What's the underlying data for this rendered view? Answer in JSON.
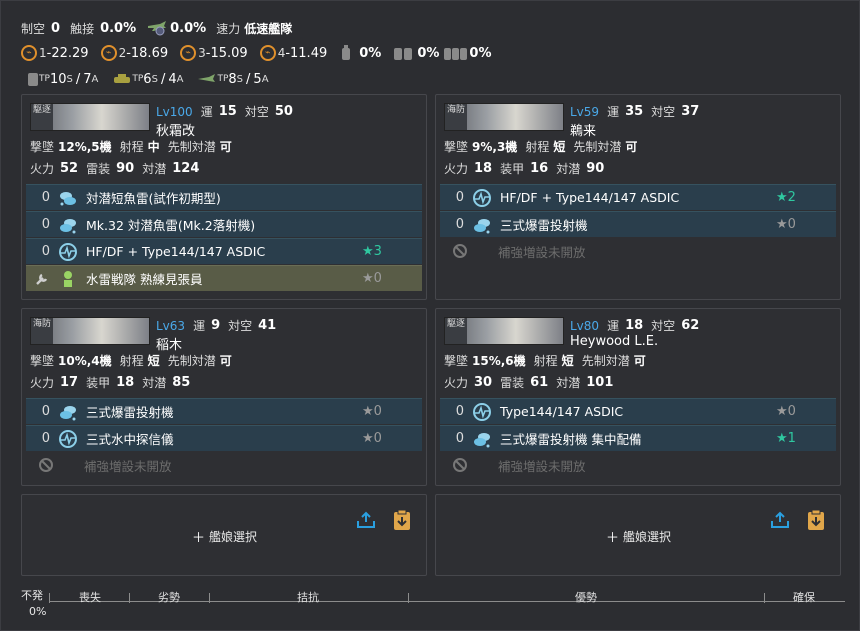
{
  "summary": {
    "air_label": "制空",
    "air_value": "0",
    "contact_label": "触接",
    "contact_value": "0.0%",
    "other_value": "0.0%",
    "speed_label": "速力",
    "speed_value": "低速艦隊",
    "los": [
      {
        "icon": "los-icon",
        "sub": "1",
        "value": "-22.29"
      },
      {
        "icon": "los-icon",
        "sub": "2",
        "value": "-18.69"
      },
      {
        "icon": "los-icon",
        "sub": "3",
        "value": "-15.09"
      },
      {
        "icon": "los-icon",
        "sub": "4",
        "value": "-11.49"
      }
    ],
    "drums": [
      "0%",
      "0%",
      "0%"
    ],
    "tp": [
      {
        "icon": "drum-tp-icon",
        "s": "10",
        "a": "7"
      },
      {
        "icon": "tank-tp-icon",
        "s": "6",
        "a": "4"
      },
      {
        "icon": "seaplane-tp-icon",
        "s": "8",
        "a": "5"
      }
    ],
    "tp_prefix": "TP",
    "tp_s": "S",
    "tp_a": "A"
  },
  "ships": [
    {
      "type_tag": "駆逐",
      "level": "Lv100",
      "luck_label": "運",
      "luck": "15",
      "aa_label": "対空",
      "aa": "50",
      "name": "秋霜改",
      "line2": [
        {
          "label": "撃墜",
          "value": "12%,5機"
        },
        {
          "label": "射程",
          "value": "中"
        },
        {
          "label": "先制対潜",
          "value": "可"
        }
      ],
      "line3": [
        {
          "label": "火力",
          "value": "52"
        },
        {
          "label": "雷装",
          "value": "90"
        },
        {
          "label": "対潜",
          "value": "124"
        }
      ],
      "equips": [
        {
          "count": "0",
          "icon": "depth-charge-icon",
          "name": "対潜短魚雷(試作初期型)",
          "star": ""
        },
        {
          "count": "0",
          "icon": "depth-charge-icon",
          "name": "Mk.32 対潜魚雷(Mk.2落射機)",
          "star": ""
        },
        {
          "count": "0",
          "icon": "sonar-icon",
          "name": "HF/DF + Type144/147 ASDIC",
          "star": "3"
        }
      ],
      "expansion": {
        "icon": "lookout-icon",
        "name": "水雷戦隊 熟練見張員",
        "star": "0"
      }
    },
    {
      "type_tag": "海防",
      "level": "Lv59",
      "luck_label": "運",
      "luck": "35",
      "aa_label": "対空",
      "aa": "37",
      "name": "鵜来",
      "line2": [
        {
          "label": "撃墜",
          "value": "9%,3機"
        },
        {
          "label": "射程",
          "value": "短"
        },
        {
          "label": "先制対潜",
          "value": "可"
        }
      ],
      "line3": [
        {
          "label": "火力",
          "value": "18"
        },
        {
          "label": "装甲",
          "value": "16"
        },
        {
          "label": "対潜",
          "value": "90"
        }
      ],
      "equips": [
        {
          "count": "0",
          "icon": "sonar-icon",
          "name": "HF/DF + Type144/147 ASDIC",
          "star": "2"
        },
        {
          "count": "0",
          "icon": "depth-charge-icon",
          "name": "三式爆雷投射機",
          "star": "0"
        }
      ],
      "locked": "補強増設未開放"
    },
    {
      "type_tag": "海防",
      "level": "Lv63",
      "luck_label": "運",
      "luck": "9",
      "aa_label": "対空",
      "aa": "41",
      "name": "稲木",
      "line2": [
        {
          "label": "撃墜",
          "value": "10%,4機"
        },
        {
          "label": "射程",
          "value": "短"
        },
        {
          "label": "先制対潜",
          "value": "可"
        }
      ],
      "line3": [
        {
          "label": "火力",
          "value": "17"
        },
        {
          "label": "装甲",
          "value": "18"
        },
        {
          "label": "対潜",
          "value": "85"
        }
      ],
      "equips": [
        {
          "count": "0",
          "icon": "depth-charge-icon",
          "name": "三式爆雷投射機",
          "star": "0"
        },
        {
          "count": "0",
          "icon": "sonar-icon",
          "name": "三式水中探信儀",
          "star": "0"
        }
      ],
      "locked": "補強増設未開放"
    },
    {
      "type_tag": "駆逐",
      "level": "Lv80",
      "luck_label": "運",
      "luck": "18",
      "aa_label": "対空",
      "aa": "62",
      "name": "Heywood L.E.",
      "line2": [
        {
          "label": "撃墜",
          "value": "15%,6機"
        },
        {
          "label": "射程",
          "value": "短"
        },
        {
          "label": "先制対潜",
          "value": "可"
        }
      ],
      "line3": [
        {
          "label": "火力",
          "value": "30"
        },
        {
          "label": "雷装",
          "value": "61"
        },
        {
          "label": "対潜",
          "value": "101"
        }
      ],
      "equips": [
        {
          "count": "0",
          "icon": "sonar-icon",
          "name": "Type144/147 ASDIC",
          "star": "0"
        },
        {
          "count": "0",
          "icon": "depth-charge-icon",
          "name": "三式爆雷投射機 集中配備",
          "star": "1"
        }
      ],
      "locked": "補強増設未開放"
    }
  ],
  "add_slot_label": "艦娘選択",
  "gauge": {
    "left_label": "不発",
    "left_value": "0%",
    "labels": [
      "喪失",
      "劣勢",
      "拮抗",
      "優勢",
      "確保"
    ]
  },
  "colors": {
    "accent": "#4aa8e8",
    "star": "#2fc8a0",
    "equip_bg": "#2a3e4c",
    "expansion_bg": "#595c47",
    "los": "#e0902c",
    "upload": "#2a9fdf",
    "clipboard": "#e0a64a"
  }
}
